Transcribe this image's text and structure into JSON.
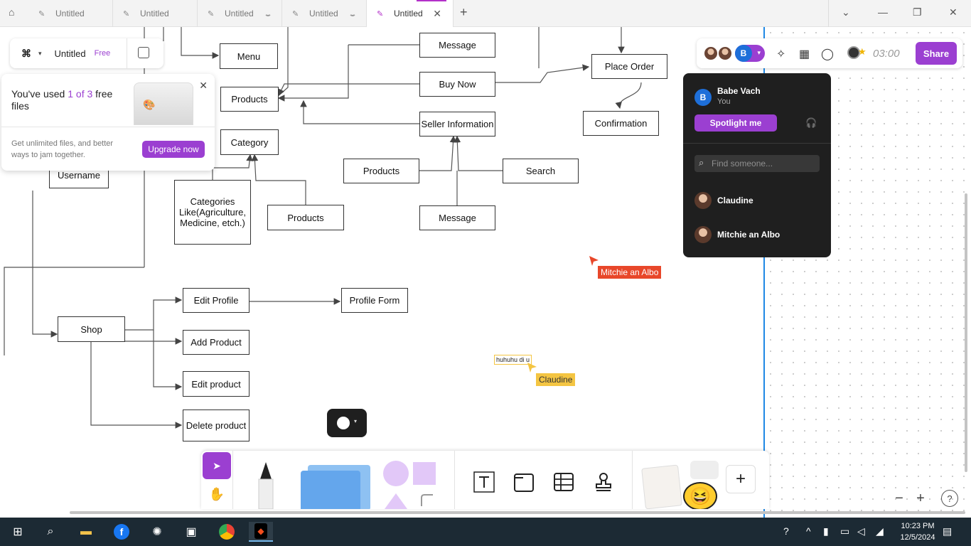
{
  "browser": {
    "tabs": [
      {
        "label": "Untitled",
        "loading": false
      },
      {
        "label": "Untitled",
        "loading": false
      },
      {
        "label": "Untitled",
        "loading": true
      },
      {
        "label": "Untitled",
        "loading": true
      },
      {
        "label": "Untitled",
        "active": true
      }
    ],
    "new_tab": "+",
    "close_tab": "✕"
  },
  "file": {
    "name": "Untitled",
    "plan_badge": "Free"
  },
  "files_popup": {
    "title_prefix": "You've used ",
    "title_highlight": "1 of 3",
    "title_suffix": " free files",
    "body": "Get unlimited files, and better ways to jam together.",
    "upgrade_label": "Upgrade now"
  },
  "toolbar": {
    "user_initial": "B",
    "timer": "03:00",
    "share_label": "Share"
  },
  "spotlight_panel": {
    "me_initial": "B",
    "me_name": "Babe Vach",
    "me_subtitle": "You",
    "spotlight_label": "Spotlight me",
    "search_placeholder": "Find someone...",
    "people": [
      "Claudine",
      "Mitchie an Albo"
    ]
  },
  "diagram": {
    "nodes": {
      "menu": "Menu",
      "products_main": "Products",
      "category": "Category",
      "username": "Username",
      "categories_like": "Categories Like(Agriculture, Medicine, etch.)",
      "products_mid": "Products",
      "message_top": "Message",
      "buy_now": "Buy Now",
      "seller_info": "Seller Information",
      "products_left": "Products",
      "search": "Search",
      "message_bottom": "Message",
      "place_order": "Place  Order",
      "confirmation": "Confirmation",
      "shop": "Shop",
      "edit_profile": "Edit Profile",
      "profile_form": "Profile Form",
      "add_product": "Add Product",
      "edit_product": "Edit product",
      "delete_product": "Delete product"
    },
    "typing_text": "huhuhu di u"
  },
  "cursors": [
    {
      "name": "Mitchie an Albo",
      "color": "#e8472a"
    },
    {
      "name": "Claudine",
      "color": "#f4c542"
    }
  ],
  "accent_color": "#9b3fd1",
  "zoom": {
    "minus": "−",
    "plus": "+",
    "help": "?"
  },
  "taskbar": {
    "time": "10:23 PM",
    "date": "12/5/2024"
  }
}
